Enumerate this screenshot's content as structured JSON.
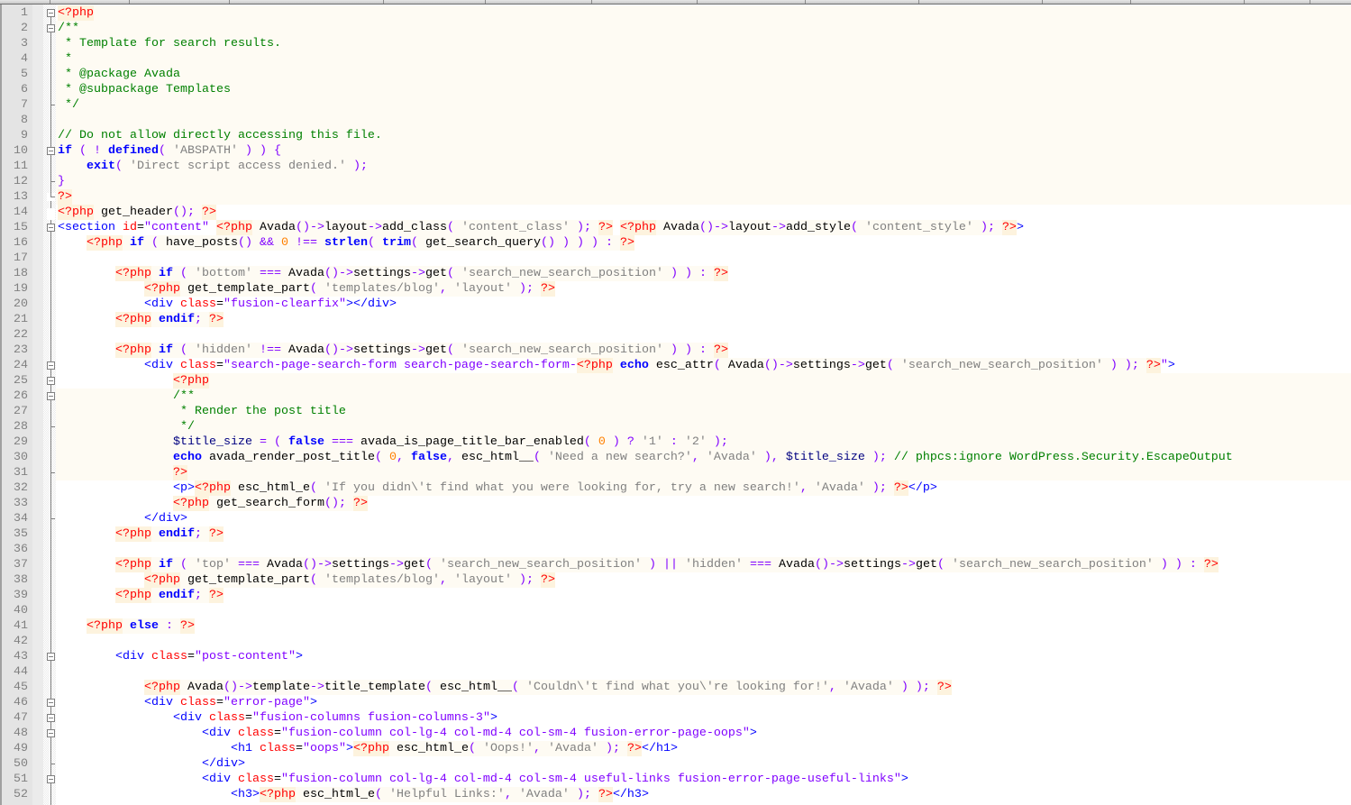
{
  "editor": {
    "language": "php",
    "keywords": [
      "if",
      "else",
      "endif",
      "echo",
      "false",
      "true",
      "defined",
      "exit",
      "strlen",
      "trim"
    ],
    "colors": {
      "php_tag": "#ff0000",
      "comment": "#008000",
      "string": "#808080",
      "number": "#ff8000",
      "keyword": "#0000ff",
      "variable": "#000080",
      "operator": "#8000ff",
      "html_tag": "#0000ff",
      "html_attribute": "#ff0000",
      "html_value": "#8000ff",
      "php_background": "#fefbf3"
    },
    "lines": [
      {
        "n": "1",
        "text": "<?php",
        "fold": "box"
      },
      {
        "n": "2",
        "text": "/**",
        "fold": "box"
      },
      {
        "n": "3",
        "text": " * Template for search results."
      },
      {
        "n": "4",
        "text": " *"
      },
      {
        "n": "5",
        "text": " * @package Avada"
      },
      {
        "n": "6",
        "text": " * @subpackage Templates"
      },
      {
        "n": "7",
        "text": " */",
        "fold": "tick"
      },
      {
        "n": "8",
        "text": ""
      },
      {
        "n": "9",
        "text": "// Do not allow directly accessing this file."
      },
      {
        "n": "10",
        "text": "if ( ! defined( 'ABSPATH' ) ) {",
        "fold": "box"
      },
      {
        "n": "11",
        "text": "    exit( 'Direct script access denied.' );"
      },
      {
        "n": "12",
        "text": "}",
        "fold": "tick"
      },
      {
        "n": "13",
        "text": "?>",
        "fold": "corner"
      },
      {
        "n": "14",
        "text": "<?php get_header(); ?>",
        "fold": "after"
      },
      {
        "n": "15",
        "text": "<section id=\"content\" <?php Avada()->layout->add_class( 'content_class' ); ?> <?php Avada()->layout->add_style( 'content_style' ); ?>>",
        "fold": "box"
      },
      {
        "n": "16",
        "text": "    <?php if ( have_posts() && 0 !== strlen( trim( get_search_query() ) ) ) : ?>"
      },
      {
        "n": "17",
        "text": ""
      },
      {
        "n": "18",
        "text": "        <?php if ( 'bottom' === Avada()->settings->get( 'search_new_search_position' ) ) : ?>"
      },
      {
        "n": "19",
        "text": "            <?php get_template_part( 'templates/blog', 'layout' ); ?>"
      },
      {
        "n": "20",
        "text": "            <div class=\"fusion-clearfix\"></div>"
      },
      {
        "n": "21",
        "text": "        <?php endif; ?>"
      },
      {
        "n": "22",
        "text": ""
      },
      {
        "n": "23",
        "text": "        <?php if ( 'hidden' !== Avada()->settings->get( 'search_new_search_position' ) ) : ?>"
      },
      {
        "n": "24",
        "text": "            <div class=\"search-page-search-form search-page-search-form-<?php echo esc_attr( Avada()->settings->get( 'search_new_search_position' ) ); ?>\">",
        "fold": "box"
      },
      {
        "n": "25",
        "text": "                <?php",
        "fold": "box"
      },
      {
        "n": "26",
        "text": "                /**",
        "fold": "box"
      },
      {
        "n": "27",
        "text": "                 * Render the post title"
      },
      {
        "n": "28",
        "text": "                 */",
        "fold": "tick"
      },
      {
        "n": "29",
        "text": "                $title_size = ( false === avada_is_page_title_bar_enabled( 0 ) ? '1' : '2' );"
      },
      {
        "n": "30",
        "text": "                echo avada_render_post_title( 0, false, esc_html__( 'Need a new search?', 'Avada' ), $title_size ); // phpcs:ignore WordPress.Security.EscapeOutput"
      },
      {
        "n": "31",
        "text": "                ?>",
        "fold": "tick"
      },
      {
        "n": "32",
        "text": "                <p><?php esc_html_e( 'If you didn\\'t find what you were looking for, try a new search!', 'Avada' ); ?></p>"
      },
      {
        "n": "33",
        "text": "                <?php get_search_form(); ?>"
      },
      {
        "n": "34",
        "text": "            </div>",
        "fold": "tick"
      },
      {
        "n": "35",
        "text": "        <?php endif; ?>"
      },
      {
        "n": "36",
        "text": ""
      },
      {
        "n": "37",
        "text": "        <?php if ( 'top' === Avada()->settings->get( 'search_new_search_position' ) || 'hidden' === Avada()->settings->get( 'search_new_search_position' ) ) : ?>"
      },
      {
        "n": "38",
        "text": "            <?php get_template_part( 'templates/blog', 'layout' ); ?>"
      },
      {
        "n": "39",
        "text": "        <?php endif; ?>"
      },
      {
        "n": "40",
        "text": ""
      },
      {
        "n": "41",
        "text": "    <?php else : ?>"
      },
      {
        "n": "42",
        "text": ""
      },
      {
        "n": "43",
        "text": "        <div class=\"post-content\">",
        "fold": "box"
      },
      {
        "n": "44",
        "text": ""
      },
      {
        "n": "45",
        "text": "            <?php Avada()->template->title_template( esc_html__( 'Couldn\\'t find what you\\'re looking for!', 'Avada' ) ); ?>"
      },
      {
        "n": "46",
        "text": "            <div class=\"error-page\">",
        "fold": "box"
      },
      {
        "n": "47",
        "text": "                <div class=\"fusion-columns fusion-columns-3\">",
        "fold": "box"
      },
      {
        "n": "48",
        "text": "                    <div class=\"fusion-column col-lg-4 col-md-4 col-sm-4 fusion-error-page-oops\">",
        "fold": "box"
      },
      {
        "n": "49",
        "text": "                        <h1 class=\"oops\"><?php esc_html_e( 'Oops!', 'Avada' ); ?></h1>"
      },
      {
        "n": "50",
        "text": "                    </div>",
        "fold": "tick"
      },
      {
        "n": "51",
        "text": "                    <div class=\"fusion-column col-lg-4 col-md-4 col-sm-4 useful-links fusion-error-page-useful-links\">",
        "fold": "box"
      },
      {
        "n": "52",
        "text": "                        <h3><?php esc_html_e( 'Helpful Links:', 'Avada' ); ?></h3>"
      }
    ]
  }
}
